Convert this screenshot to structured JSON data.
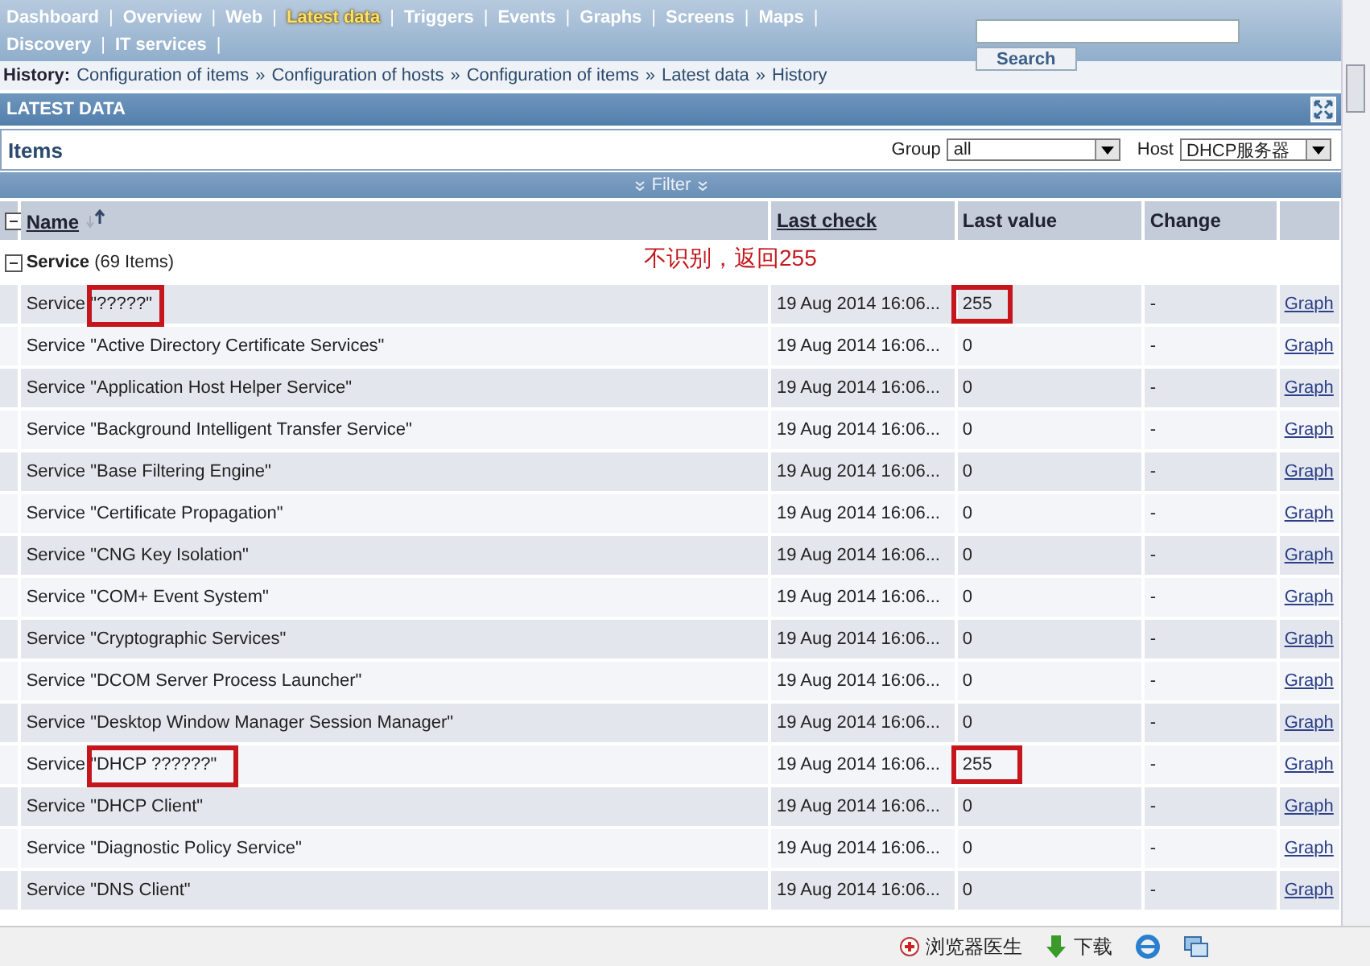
{
  "nav": {
    "rows": [
      [
        {
          "label": "Dashboard",
          "selected": false
        },
        {
          "label": "Overview",
          "selected": false
        },
        {
          "label": "Web",
          "selected": false
        },
        {
          "label": "Latest data",
          "selected": true
        },
        {
          "label": "Triggers",
          "selected": false
        },
        {
          "label": "Events",
          "selected": false
        },
        {
          "label": "Graphs",
          "selected": false
        },
        {
          "label": "Screens",
          "selected": false
        },
        {
          "label": "Maps",
          "selected": false
        }
      ],
      [
        {
          "label": "Discovery",
          "selected": false
        },
        {
          "label": "IT services",
          "selected": false
        }
      ]
    ],
    "separator": "|",
    "search_button": "Search"
  },
  "history": {
    "label": "History:",
    "items": [
      "Configuration of items",
      "Configuration of hosts",
      "Configuration of items",
      "Latest data",
      "History"
    ],
    "separator": "»"
  },
  "section_title": "LATEST DATA",
  "items_title": "Items",
  "filters": [
    {
      "label": "Group",
      "value": "all"
    },
    {
      "label": "Host",
      "value": "DHCP服务器"
    }
  ],
  "filter_bar": {
    "label": "Filter"
  },
  "table": {
    "columns": [
      {
        "label": "Name",
        "sortable": true
      },
      {
        "label": "Last check",
        "sortable": true
      },
      {
        "label": "Last value",
        "sortable": false
      },
      {
        "label": "Change",
        "sortable": false
      }
    ],
    "group": {
      "name": "Service",
      "count": "(69 Items)"
    },
    "annotation": "不识别，返回255",
    "rows": [
      {
        "name": "Service \"?????\"",
        "last_check": "19 Aug 2014 16:06...",
        "last_value": "255",
        "change": "-",
        "link": "Graph",
        "marked": true
      },
      {
        "name": "Service \"Active Directory Certificate Services\"",
        "last_check": "19 Aug 2014 16:06...",
        "last_value": "0",
        "change": "-",
        "link": "Graph",
        "marked": false
      },
      {
        "name": "Service \"Application Host Helper Service\"",
        "last_check": "19 Aug 2014 16:06...",
        "last_value": "0",
        "change": "-",
        "link": "Graph",
        "marked": false
      },
      {
        "name": "Service \"Background Intelligent Transfer Service\"",
        "last_check": "19 Aug 2014 16:06...",
        "last_value": "0",
        "change": "-",
        "link": "Graph",
        "marked": false
      },
      {
        "name": "Service \"Base Filtering Engine\"",
        "last_check": "19 Aug 2014 16:06...",
        "last_value": "0",
        "change": "-",
        "link": "Graph",
        "marked": false
      },
      {
        "name": "Service \"Certificate Propagation\"",
        "last_check": "19 Aug 2014 16:06...",
        "last_value": "0",
        "change": "-",
        "link": "Graph",
        "marked": false
      },
      {
        "name": "Service \"CNG Key Isolation\"",
        "last_check": "19 Aug 2014 16:06...",
        "last_value": "0",
        "change": "-",
        "link": "Graph",
        "marked": false
      },
      {
        "name": "Service \"COM+ Event System\"",
        "last_check": "19 Aug 2014 16:06...",
        "last_value": "0",
        "change": "-",
        "link": "Graph",
        "marked": false
      },
      {
        "name": "Service \"Cryptographic Services\"",
        "last_check": "19 Aug 2014 16:06...",
        "last_value": "0",
        "change": "-",
        "link": "Graph",
        "marked": false
      },
      {
        "name": "Service \"DCOM Server Process Launcher\"",
        "last_check": "19 Aug 2014 16:06...",
        "last_value": "0",
        "change": "-",
        "link": "Graph",
        "marked": false
      },
      {
        "name": "Service \"Desktop Window Manager Session Manager\"",
        "last_check": "19 Aug 2014 16:06...",
        "last_value": "0",
        "change": "-",
        "link": "Graph",
        "marked": false
      },
      {
        "name": "Service \"DHCP ??????\"",
        "last_check": "19 Aug 2014 16:06...",
        "last_value": "255",
        "change": "-",
        "link": "Graph",
        "marked": true
      },
      {
        "name": "Service \"DHCP Client\"",
        "last_check": "19 Aug 2014 16:06...",
        "last_value": "0",
        "change": "-",
        "link": "Graph",
        "marked": false
      },
      {
        "name": "Service \"Diagnostic Policy Service\"",
        "last_check": "19 Aug 2014 16:06...",
        "last_value": "0",
        "change": "-",
        "link": "Graph",
        "marked": false
      },
      {
        "name": "Service \"DNS Client\"",
        "last_check": "19 Aug 2014 16:06...",
        "last_value": "0",
        "change": "-",
        "link": "Graph",
        "marked": false
      }
    ]
  },
  "status_bar": {
    "items": [
      {
        "label": "浏览器医生",
        "kind": "doctor"
      },
      {
        "label": "下载",
        "kind": "download"
      }
    ]
  }
}
